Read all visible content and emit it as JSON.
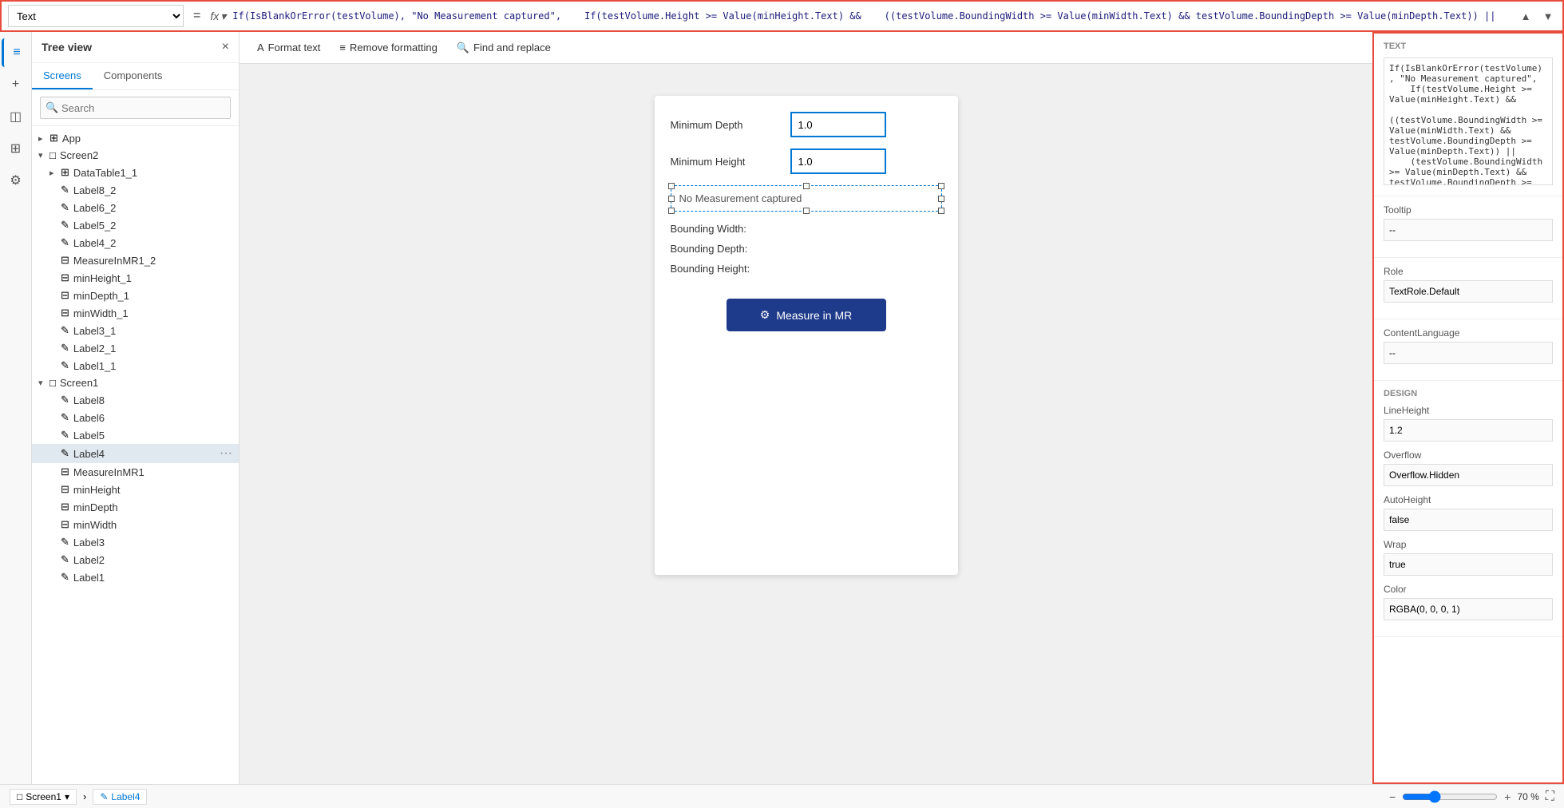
{
  "formulaBar": {
    "selectValue": "Text",
    "equalsSign": "=",
    "fxLabel": "fx",
    "formula": "If(IsBlankOrError(testVolume), \"No Measurement captured\",\n    If(testVolume.Height >= Value(minHeight.Text) &&\n    ((testVolume.BoundingWidth >= Value(minWidth.Text) && testVolume.BoundingDepth >= Value(minDepth.Text)) ||\n    (testVolume.BoundingWidth >= Value(minDepth.Text) && testVolume.BoundingDepth >= Value(minWidth.Text))),\n    \"Fit Test Succeeded\", \"Fit Test Failed\"))"
  },
  "sidebar": {
    "title": "Tree view",
    "closeLabel": "×",
    "tabs": [
      "Screens",
      "Components"
    ],
    "activeTab": "Screens",
    "search": {
      "placeholder": "Search"
    },
    "tree": [
      {
        "id": "app",
        "label": "App",
        "icon": "⊞",
        "level": 0,
        "expanded": false,
        "type": "app"
      },
      {
        "id": "screen2",
        "label": "Screen2",
        "icon": "□",
        "level": 0,
        "expanded": true,
        "type": "screen"
      },
      {
        "id": "datatable1_1",
        "label": "DataTable1_1",
        "icon": "⊞",
        "level": 1,
        "expanded": false,
        "type": "table"
      },
      {
        "id": "label8_2",
        "label": "Label8_2",
        "icon": "✎",
        "level": 1,
        "expanded": false,
        "type": "label"
      },
      {
        "id": "label6_2",
        "label": "Label6_2",
        "icon": "✎",
        "level": 1,
        "expanded": false,
        "type": "label"
      },
      {
        "id": "label5_2",
        "label": "Label5_2",
        "icon": "✎",
        "level": 1,
        "expanded": false,
        "type": "label"
      },
      {
        "id": "label4_2",
        "label": "Label4_2",
        "icon": "✎",
        "level": 1,
        "expanded": false,
        "type": "label"
      },
      {
        "id": "measureinmr1_2",
        "label": "MeasureInMR1_2",
        "icon": "⊟",
        "level": 1,
        "expanded": false,
        "type": "input"
      },
      {
        "id": "minheight_1",
        "label": "minHeight_1",
        "icon": "⊟",
        "level": 1,
        "expanded": false,
        "type": "input"
      },
      {
        "id": "mindepth_1",
        "label": "minDepth_1",
        "icon": "⊟",
        "level": 1,
        "expanded": false,
        "type": "input"
      },
      {
        "id": "minwidth_1",
        "label": "minWidth_1",
        "icon": "⊟",
        "level": 1,
        "expanded": false,
        "type": "input"
      },
      {
        "id": "label3_1",
        "label": "Label3_1",
        "icon": "✎",
        "level": 1,
        "expanded": false,
        "type": "label"
      },
      {
        "id": "label2_1",
        "label": "Label2_1",
        "icon": "✎",
        "level": 1,
        "expanded": false,
        "type": "label"
      },
      {
        "id": "label1_1",
        "label": "Label1_1",
        "icon": "✎",
        "level": 1,
        "expanded": false,
        "type": "label"
      },
      {
        "id": "screen1",
        "label": "Screen1",
        "icon": "□",
        "level": 0,
        "expanded": true,
        "type": "screen"
      },
      {
        "id": "label8",
        "label": "Label8",
        "icon": "✎",
        "level": 1,
        "expanded": false,
        "type": "label"
      },
      {
        "id": "label6",
        "label": "Label6",
        "icon": "✎",
        "level": 1,
        "expanded": false,
        "type": "label"
      },
      {
        "id": "label5",
        "label": "Label5",
        "icon": "✎",
        "level": 1,
        "expanded": false,
        "type": "label"
      },
      {
        "id": "label4",
        "label": "Label4",
        "icon": "✎",
        "level": 1,
        "expanded": false,
        "type": "label",
        "selected": true
      },
      {
        "id": "measureinmr1",
        "label": "MeasureInMR1",
        "icon": "⊟",
        "level": 1,
        "expanded": false,
        "type": "input"
      },
      {
        "id": "minheight",
        "label": "minHeight",
        "icon": "⊟",
        "level": 1,
        "expanded": false,
        "type": "input"
      },
      {
        "id": "mindepth",
        "label": "minDepth",
        "icon": "⊟",
        "level": 1,
        "expanded": false,
        "type": "input"
      },
      {
        "id": "minwidth",
        "label": "minWidth",
        "icon": "⊟",
        "level": 1,
        "expanded": false,
        "type": "input"
      },
      {
        "id": "label3",
        "label": "Label3",
        "icon": "✎",
        "level": 1,
        "expanded": false,
        "type": "label"
      },
      {
        "id": "label2",
        "label": "Label2",
        "icon": "✎",
        "level": 1,
        "expanded": false,
        "type": "label"
      },
      {
        "id": "label1",
        "label": "Label1",
        "icon": "✎",
        "level": 1,
        "expanded": false,
        "type": "label"
      }
    ]
  },
  "iconStrip": {
    "icons": [
      {
        "name": "hamburger-icon",
        "glyph": "☰"
      },
      {
        "name": "plus-icon",
        "glyph": "+"
      },
      {
        "name": "database-icon",
        "glyph": "◫"
      },
      {
        "name": "list-icon",
        "glyph": "≡"
      },
      {
        "name": "settings-icon",
        "glyph": "⚙"
      }
    ]
  },
  "toolbar": {
    "formatText": "Format text",
    "removeFormatting": "Remove formatting",
    "findAndReplace": "Find and replace"
  },
  "canvas": {
    "formFields": [
      {
        "label": "Minimum Depth",
        "value": "1.0"
      },
      {
        "label": "Minimum Height",
        "value": "1.0"
      }
    ],
    "selectedLabelText": "No Measurement captured",
    "infoRows": [
      "Bounding Width:",
      "Bounding Depth:",
      "Bounding Height:"
    ],
    "measureButton": "Measure in MR"
  },
  "propsPanel": {
    "textSectionTitle": "Text",
    "textValue": "If(IsBlankOrError(testVolume), \"No Measurement captured\",\n    If(testVolume.Height >= Value(minHeight.Text) &&\n    ((testVolume.BoundingWidth >= Value(minWidth.Text) && testVolume.BoundingDepth >= Value(minDepth.Text)) ||\n    (testVolume.BoundingWidth >= Value(minDepth.Text) && testVolume.BoundingDepth >= Value(minWidth.Text))),\n    \"Fit Test Succeeded\", \"Fit Test Failed\"))",
    "tooltipLabel": "Tooltip",
    "tooltipValue": "--",
    "roleLabel": "Role",
    "roleValue": "TextRole.Default",
    "contentLanguageLabel": "ContentLanguage",
    "contentLanguageValue": "--",
    "designSectionTitle": "DESIGN",
    "lineHeightLabel": "LineHeight",
    "lineHeightValue": "1.2",
    "overflowLabel": "Overflow",
    "overflowValue": "Overflow.Hidden",
    "autoHeightLabel": "AutoHeight",
    "autoHeightValue": "false",
    "wrapLabel": "Wrap",
    "wrapValue": "true",
    "colorLabel": "Color",
    "colorValue": "RGBA(0, 0, 0, 1)"
  },
  "statusBar": {
    "screenLabel": "Screen1",
    "elementLabel": "Label4",
    "zoomMinus": "−",
    "zoomPlus": "+",
    "zoomPercent": "70 %"
  }
}
